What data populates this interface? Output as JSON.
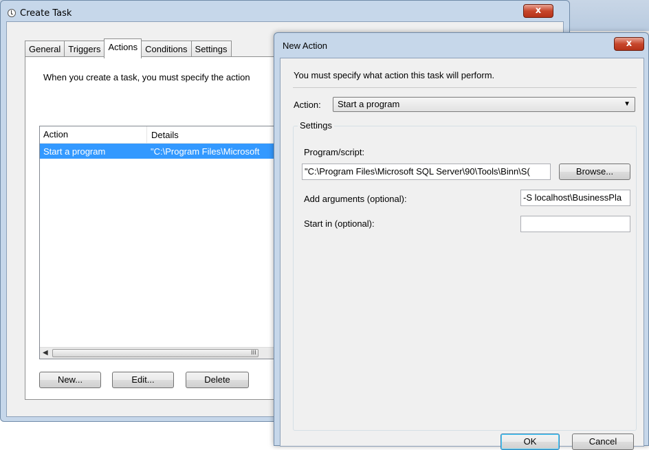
{
  "create_task": {
    "title": "Create Task",
    "close_label": "x",
    "tabs": [
      {
        "label": "General"
      },
      {
        "label": "Triggers"
      },
      {
        "label": "Actions"
      },
      {
        "label": "Conditions"
      },
      {
        "label": "Settings"
      }
    ],
    "active_tab": "Actions",
    "description": "When you create a task, you must specify the action",
    "columns": [
      "Action",
      "Details"
    ],
    "rows": [
      {
        "action": "Start a program",
        "details": "\"C:\\Program Files\\Microsoft"
      }
    ],
    "scroll_glyph": "III",
    "buttons": {
      "new": "New...",
      "edit": "Edit...",
      "delete": "Delete"
    }
  },
  "new_action": {
    "title": "New Action",
    "close_label": "x",
    "instruction": "You must specify what action this task will perform.",
    "action_label": "Action:",
    "action_value": "Start a program",
    "settings_group": "Settings",
    "program_label": "Program/script:",
    "program_value": "\"C:\\Program Files\\Microsoft SQL Server\\90\\Tools\\Binn\\S(",
    "browse_label": "Browse...",
    "arguments_label": "Add arguments (optional):",
    "arguments_value": "-S localhost\\BusinessPla",
    "start_in_label": "Start in (optional):",
    "start_in_value": "",
    "ok_label": "OK",
    "cancel_label": "Cancel"
  },
  "colors": {
    "selection": "#3399ff",
    "close": "#c7462b",
    "frame": "#c6d7ea"
  }
}
